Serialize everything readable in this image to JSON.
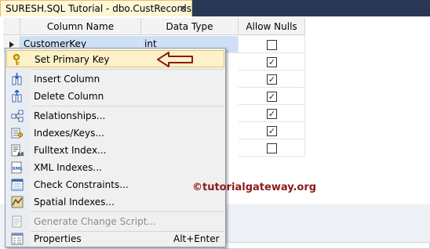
{
  "document_tab": {
    "title": "SURESH.SQL Tutorial - dbo.CustRecords",
    "close_glyph": "✕"
  },
  "grid": {
    "headers": {
      "column_name": "Column Name",
      "data_type": "Data Type",
      "allow_nulls": "Allow Nulls"
    },
    "first_row": {
      "column_name": "CustomerKey",
      "data_type": "int"
    },
    "allow_nulls": [
      false,
      true,
      true,
      true,
      true,
      true,
      false
    ]
  },
  "context_menu": {
    "items": [
      {
        "label": "Set Primary Key",
        "icon": "primary-key-icon",
        "highlighted": true
      },
      {
        "label": "Insert Column",
        "icon": "insert-column-icon"
      },
      {
        "label": "Delete Column",
        "icon": "delete-column-icon"
      },
      {
        "label": "Relationships...",
        "icon": "relationships-icon"
      },
      {
        "label": "Indexes/Keys...",
        "icon": "indexes-keys-icon"
      },
      {
        "label": "Fulltext Index...",
        "icon": "fulltext-index-icon"
      },
      {
        "label": "XML Indexes...",
        "icon": "xml-indexes-icon"
      },
      {
        "label": "Check Constraints...",
        "icon": "check-constraints-icon"
      },
      {
        "label": "Spatial Indexes...",
        "icon": "spatial-indexes-icon"
      },
      {
        "label": "Generate Change Script...",
        "icon": "generate-script-icon",
        "disabled": true
      },
      {
        "label": "Properties",
        "icon": "properties-icon",
        "shortcut": "Alt+Enter"
      }
    ]
  },
  "watermark": "©tutorialgateway.org",
  "colors": {
    "highlight": "#fdf1c9",
    "selection": "#cfe0f6",
    "annotation_arrow": "#8b1a1a"
  }
}
